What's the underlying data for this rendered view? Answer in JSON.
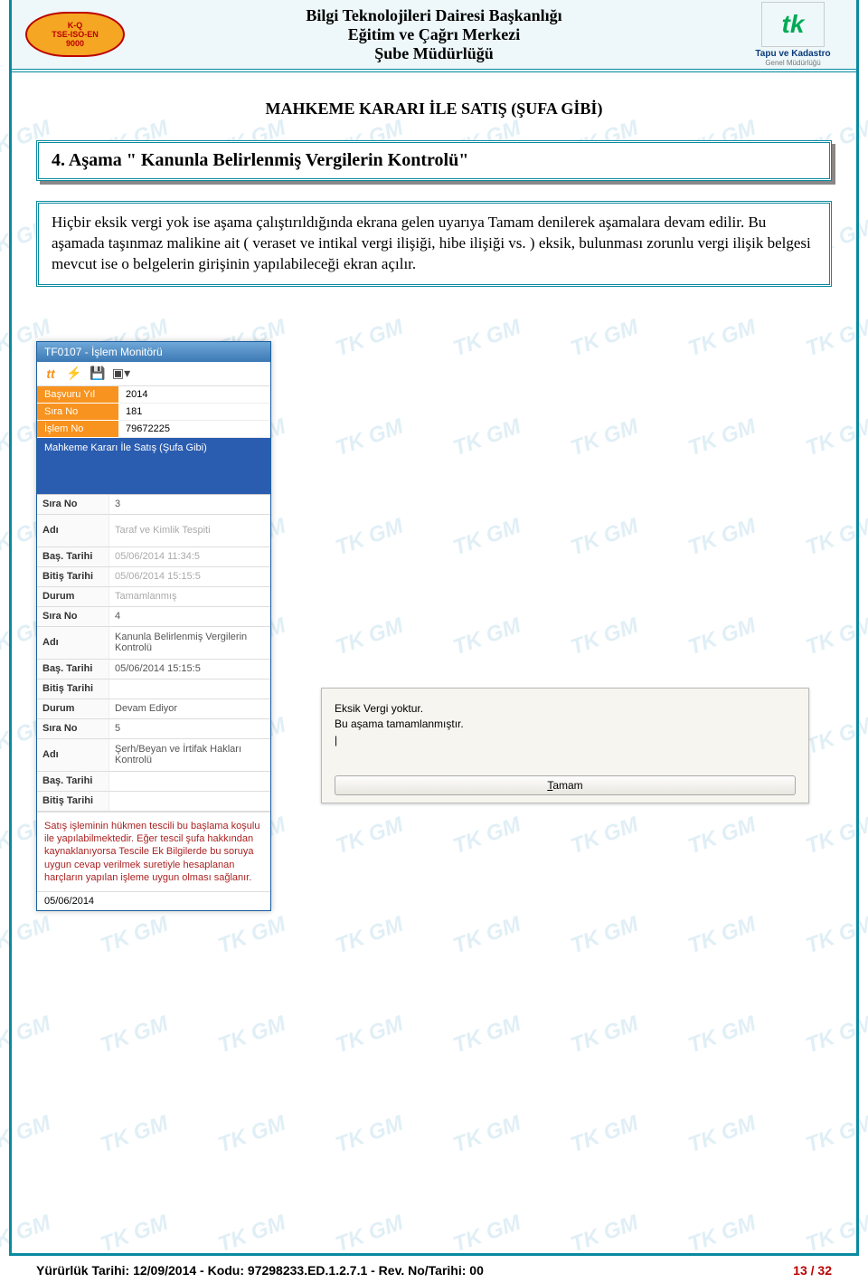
{
  "watermark_text": "TK GM",
  "header": {
    "logo_left": {
      "line1": "K-Q",
      "line2": "TSE-ISO-EN",
      "line3": "9000"
    },
    "center_lines": [
      "Bilgi Teknolojileri Dairesi Başkanlığı",
      "Eğitim ve Çağrı Merkezi",
      "Şube Müdürlüğü"
    ],
    "logo_right": {
      "mark": "tk",
      "caption": "Tapu ve Kadastro",
      "sub": "Genel Müdürlüğü"
    }
  },
  "doc_title": "MAHKEME KARARI İLE SATIŞ (ŞUFA GİBİ)",
  "step_title": "4. Aşama \" Kanunla Belirlenmiş Vergilerin Kontrolü\"",
  "description": "Hiçbir eksik vergi yok ise aşama çalıştırıldığında ekrana gelen uyarıya Tamam denilerek aşamalara devam edilir. Bu aşamada taşınmaz malikine ait ( veraset ve intikal vergi ilişiği, hibe ilişiği vs. ) eksik, bulunması zorunlu vergi ilişik belgesi mevcut ise o belgelerin girişinin yapılabileceği ekran açılır.",
  "app": {
    "title": "TF0107 - İşlem Monitörü",
    "toolbar_icons": [
      "app",
      "bolt",
      "save",
      "crop"
    ],
    "info": {
      "basvuru_yil_lab": "Başvuru Yıl",
      "basvuru_yil": "2014",
      "sira_no_lab": "Sıra No",
      "sira_no": "181",
      "islem_no_lab": "İşlem No",
      "islem_no": "79672225"
    },
    "op_name": "Mahkeme Kararı İle Satış (Şufa Gibi)",
    "grid_labels": {
      "sira_no": "Sıra No",
      "adi": "Adı",
      "bas_tarihi": "Baş. Tarihi",
      "bitis_tarihi": "Bitiş Tarihi",
      "durum": "Durum"
    },
    "steps": [
      {
        "sira": "3",
        "adi": "Taraf ve Kimlik Tespiti",
        "bas": "05/06/2014 11:34:5",
        "bitis": "05/06/2014 15:15:5",
        "durum": "Tamamlanmış"
      },
      {
        "sira": "4",
        "adi": "Kanunla Belirlenmiş Vergilerin Kontrolü",
        "bas": "05/06/2014 15:15:5",
        "bitis": "",
        "durum": "Devam Ediyor"
      },
      {
        "sira": "5",
        "adi": "Şerh/Beyan ve İrtifak Hakları Kontrolü",
        "bas": "",
        "bitis": "",
        "durum": ""
      }
    ],
    "note": "Satış işleminin hükmen tescili bu başlama koşulu ile yapılabilmektedir. Eğer tescil şufa hakkından kaynaklanıyorsa Tescile Ek Bilgilerde bu soruya uygun cevap verilmek suretiyle hesaplanan harçların yapılan işleme uygun olması sağlanır.",
    "status_date": "05/06/2014"
  },
  "dialog": {
    "msg_line1": "Eksik Vergi yoktur.",
    "msg_line2": "Bu aşama tamamlanmıştır.",
    "button": "Tamam"
  },
  "footer": {
    "left": "Yürürlük Tarihi: 12/09/2014 - Kodu: 97298233.ED.1.2.7.1 - Rev. No/Tarihi: 00",
    "page": "13 / 32"
  }
}
